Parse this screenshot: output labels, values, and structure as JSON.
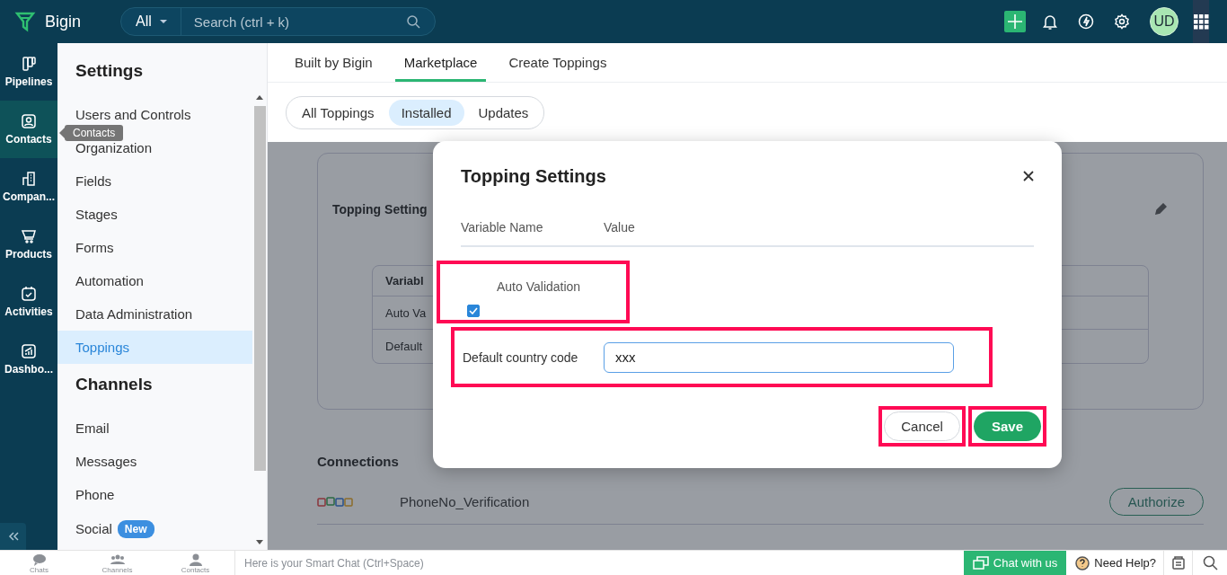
{
  "app": {
    "name": "Bigin"
  },
  "search": {
    "scope": "All",
    "placeholder": "Search (ctrl + k)"
  },
  "user": {
    "initials": "UD"
  },
  "rail": {
    "items": [
      {
        "label": "Pipelines",
        "selected": false
      },
      {
        "label": "Contacts",
        "selected": true
      },
      {
        "label": "Compan...",
        "selected": false
      },
      {
        "label": "Products",
        "selected": false
      },
      {
        "label": "Activities",
        "selected": false
      },
      {
        "label": "Dashbo...",
        "selected": false
      }
    ],
    "tooltip": "Contacts"
  },
  "settings": {
    "sections": [
      {
        "title": "Settings",
        "items": [
          {
            "label": "Users and Controls",
            "selected": false
          },
          {
            "label": "Organization",
            "selected": false
          },
          {
            "label": "Fields",
            "selected": false
          },
          {
            "label": "Stages",
            "selected": false
          },
          {
            "label": "Forms",
            "selected": false
          },
          {
            "label": "Automation",
            "selected": false
          },
          {
            "label": "Data Administration",
            "selected": false
          },
          {
            "label": "Toppings",
            "selected": true
          }
        ]
      },
      {
        "title": "Channels",
        "items": [
          {
            "label": "Email",
            "selected": false
          },
          {
            "label": "Messages",
            "selected": false
          },
          {
            "label": "Phone",
            "selected": false
          },
          {
            "label": "Social",
            "badge": "New",
            "selected": false
          }
        ]
      }
    ]
  },
  "tabs": [
    {
      "label": "Built by Bigin",
      "selected": false
    },
    {
      "label": "Marketplace",
      "selected": true
    },
    {
      "label": "Create Toppings",
      "selected": false
    }
  ],
  "filters": [
    {
      "label": "All Toppings",
      "selected": false
    },
    {
      "label": "Installed",
      "selected": true
    },
    {
      "label": "Updates",
      "selected": false
    }
  ],
  "background": {
    "card_title": "Topping Setting",
    "table": {
      "header": "Variabl",
      "rows": [
        "Auto Va",
        "Default"
      ]
    },
    "connections": {
      "title": "Connections",
      "items": [
        {
          "name": "PhoneNo_Verification",
          "action": "Authorize"
        }
      ]
    }
  },
  "dialog": {
    "title": "Topping Settings",
    "columns": [
      "Variable Name",
      "Value"
    ],
    "fields": [
      {
        "kind": "checkbox",
        "label": "Auto Validation",
        "checked": true,
        "highlighted": true
      },
      {
        "kind": "text",
        "label": "Default country code",
        "value": "xxx",
        "highlighted": true
      }
    ],
    "buttons": [
      {
        "label": "Cancel",
        "kind": "secondary",
        "highlighted": true
      },
      {
        "label": "Save",
        "kind": "primary",
        "highlighted": true
      }
    ]
  },
  "footer": {
    "items": [
      {
        "label": "Chats"
      },
      {
        "label": "Channels"
      },
      {
        "label": "Contacts"
      }
    ],
    "smart_chat_placeholder": "Here is your Smart Chat (Ctrl+Space)",
    "chat_button": "Chat with us",
    "help": "Need Help?"
  }
}
